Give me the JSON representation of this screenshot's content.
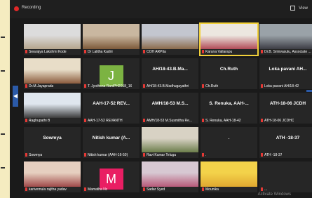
{
  "topbar": {
    "recording_label": "Recording",
    "view_label": "View"
  },
  "tiles": [
    {
      "name": "Swarajya Lakshmi Kode",
      "big": "",
      "kind": "photo",
      "colors": [
        "#dcdcdc",
        "#b5a48c"
      ]
    },
    {
      "name": "Dr Lalitha Kadiri",
      "big": "",
      "kind": "photo",
      "colors": [
        "#c9b7a0",
        "#7d5a3a"
      ]
    },
    {
      "name": "COH ARPita",
      "big": "",
      "kind": "photo",
      "colors": [
        "#c3c6cf",
        "#8b6b4b"
      ]
    },
    {
      "name": "Karuna Vallarapu",
      "big": "",
      "kind": "photo",
      "colors": [
        "#ece7e0",
        "#b04b56"
      ],
      "highlight": true
    },
    {
      "name": "Dr.B. Srinivasulu, Associate ...",
      "big": "",
      "kind": "photo",
      "colors": [
        "#9aa2a8",
        "#3c3c44"
      ]
    },
    {
      "name": "Dr.M.Jayaprada",
      "big": "",
      "kind": "photo",
      "colors": [
        "#e8ddc8",
        "#8a5a3c"
      ]
    },
    {
      "name": "T. Jyothsna RaniPH2018_16",
      "big": "",
      "kind": "avatar",
      "avatar_letter": "J",
      "avatar_color": "#7cb342"
    },
    {
      "name": "AH/18-43.B.Madhugayathri",
      "big": "AH/18-43.B.Ma...",
      "kind": "text"
    },
    {
      "name": "Ch.Ruth",
      "big": "Ch.Ruth",
      "kind": "text"
    },
    {
      "name": "Loka pavani AH/18-42",
      "big": "Loka pavani AH...",
      "kind": "text"
    },
    {
      "name": "Raghupathi B",
      "big": "",
      "kind": "photo",
      "colors": [
        "#dfe6ee",
        "#3b3b3b"
      ]
    },
    {
      "name": "AAH-17-52 REVANTH",
      "big": "AAH-17-52 REV...",
      "kind": "text"
    },
    {
      "name": "AMH/18-53 M.Susmitha Re...",
      "big": "AMH/18-53 M.S...",
      "kind": "text"
    },
    {
      "name": "S. Renuka, AAH-18-42",
      "big": "S. Renuka, AAH-...",
      "kind": "text"
    },
    {
      "name": "ATH-18-06 JCDHC",
      "big": "ATH-18-06 JCDH",
      "kind": "text"
    },
    {
      "name": "Sowmya",
      "big": "Sowmya",
      "kind": "text"
    },
    {
      "name": "Nitish kumar (AAH-16-50)",
      "big": "Nitish kumar (A...",
      "kind": "text"
    },
    {
      "name": "Ravi Kumar Telugu",
      "big": "",
      "kind": "photo",
      "colors": [
        "#d8d2c4",
        "#6b7d4a"
      ]
    },
    {
      "name": ".",
      "big": ".",
      "kind": "text"
    },
    {
      "name": "ATH -18-37",
      "big": "ATH -18-37",
      "kind": "text"
    },
    {
      "name": "karivemula rajitha yadav",
      "big": "",
      "kind": "photo",
      "colors": [
        "#e6cfc0",
        "#a04a4a"
      ]
    },
    {
      "name": "Mamatha Nc",
      "big": "",
      "kind": "avatar",
      "avatar_letter": "M",
      "avatar_color": "#e91e63"
    },
    {
      "name": "Sadar Syed",
      "big": "",
      "kind": "photo",
      "colors": [
        "#d7c8d2",
        "#b85a7a"
      ]
    },
    {
      "name": "Mounika",
      "big": "",
      "kind": "photo",
      "colors": [
        "#f3d24a",
        "#e0a830"
      ]
    },
    {
      "name": "...",
      "big": "",
      "kind": "text"
    }
  ],
  "watermark": "Activate Windows"
}
